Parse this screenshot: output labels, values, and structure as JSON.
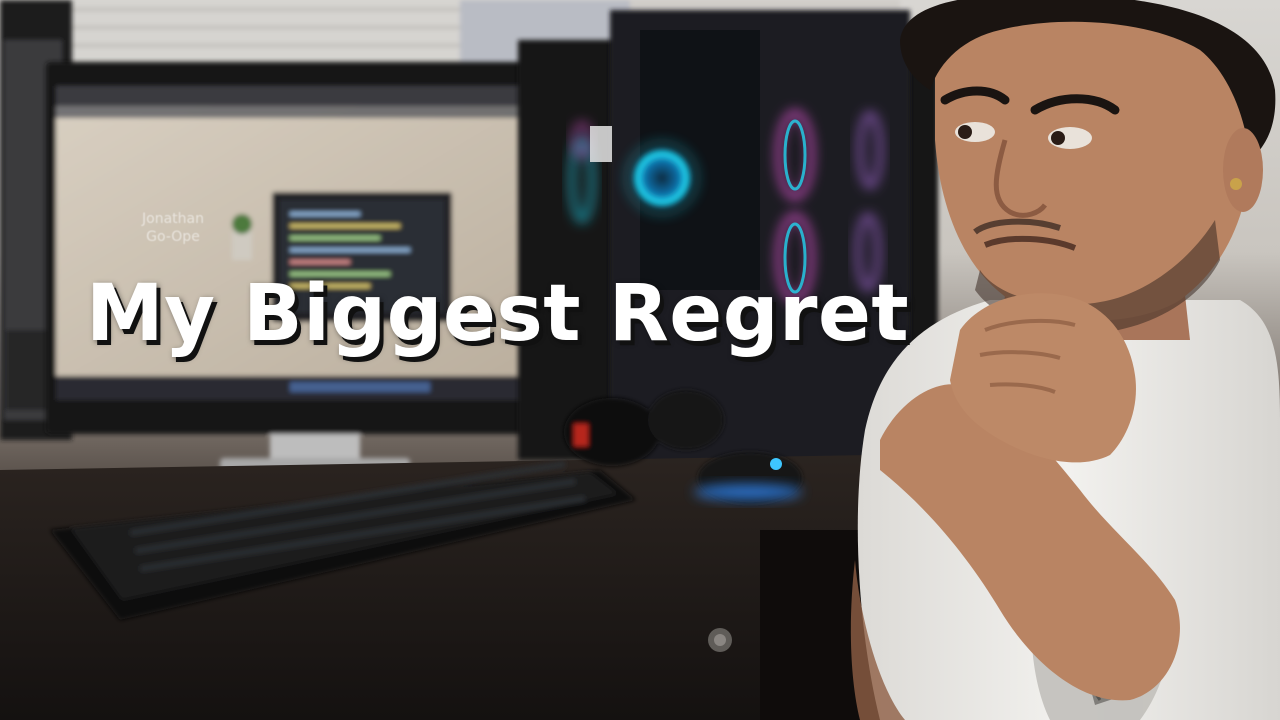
{
  "thumbnail": {
    "headline": "My Biggest Regret",
    "screen_name_line1": "Jonathan",
    "screen_name_line2": "Go-Ope"
  },
  "palette": {
    "wall": "#d8d6d2",
    "desk": "#1e1916",
    "shirt": "#ecebe8",
    "skin": "#b98463",
    "rgb_cyan": "#22d3ee",
    "rgb_pink": "#e357d6",
    "text": "#ffffff",
    "text_shadow": "#111111"
  }
}
